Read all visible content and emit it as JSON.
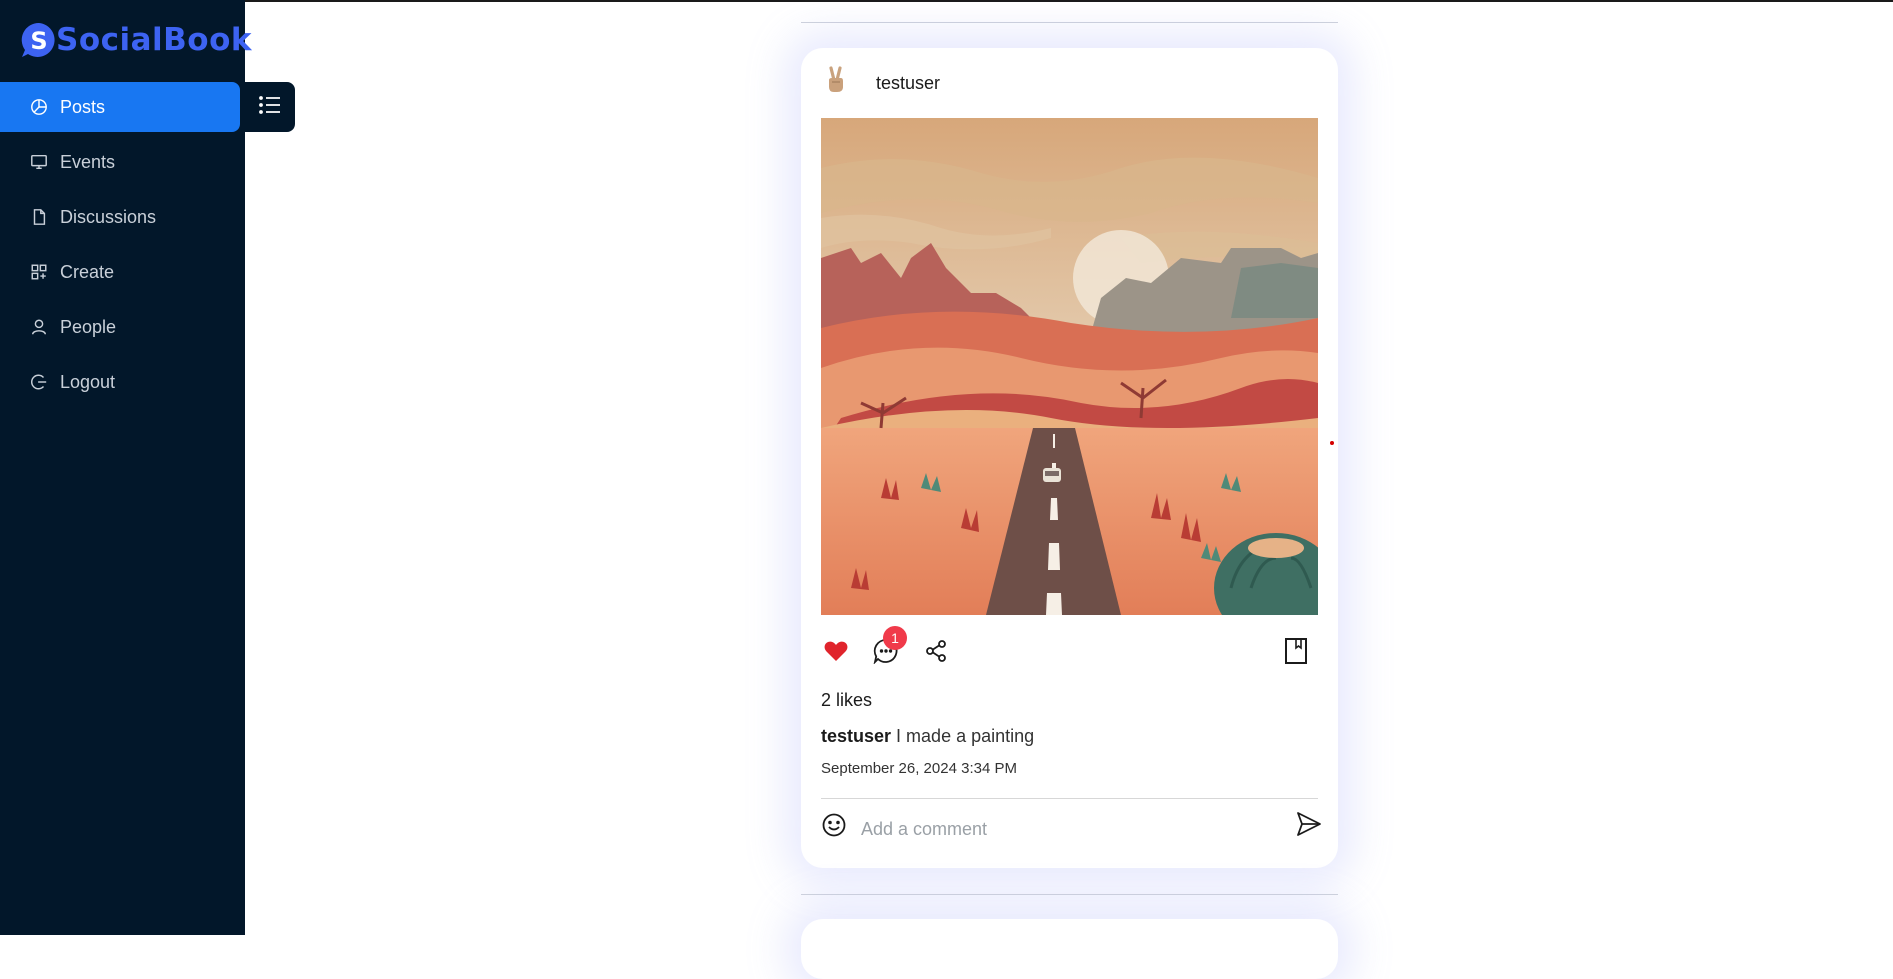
{
  "app": {
    "name": "SocialBook"
  },
  "sidebar": {
    "items": [
      {
        "label": "Posts",
        "icon": "pie-chart-icon",
        "active": true
      },
      {
        "label": "Events",
        "icon": "monitor-icon",
        "active": false
      },
      {
        "label": "Discussions",
        "icon": "document-icon",
        "active": false
      },
      {
        "label": "Create",
        "icon": "grid-icon",
        "active": false
      },
      {
        "label": "People",
        "icon": "user-icon",
        "active": false
      },
      {
        "label": "Logout",
        "icon": "logout-icon",
        "active": false
      }
    ],
    "toggle_icon": "list-icon"
  },
  "post": {
    "username": "testuser",
    "avatar_icon": "victory-hand-emoji",
    "image_icon": "desert-road-painting",
    "liked": true,
    "comment_count": "1",
    "likes_text": "2 likes",
    "caption_user": "testuser",
    "caption_text": "I made a painting",
    "date": "September 26, 2024 3:34 PM",
    "comment_placeholder": "Add a comment"
  },
  "colors": {
    "sidebar_bg": "#02172a",
    "active_item": "#1877f2",
    "brand": "#3d63f2",
    "like_red": "#e0242c",
    "badge": "#f03a4a"
  }
}
